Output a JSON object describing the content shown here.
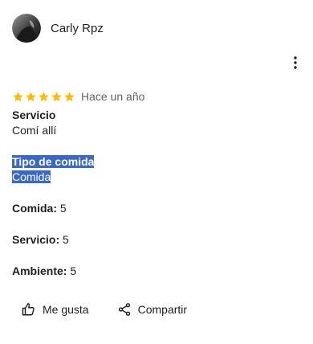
{
  "review": {
    "author": "Carly Rpz",
    "rating": 5,
    "rating_max": 5,
    "time_ago": "Hace un año",
    "colors": {
      "star": "#fbbc04",
      "selection": "#3a68c9"
    },
    "fields": {
      "servicio_title": "Servicio",
      "servicio_value": "Comí allí",
      "tipo_comida_title": "Tipo de comida",
      "tipo_comida_value": "Comida"
    },
    "ratings": [
      {
        "label": "Comida:",
        "value": "5"
      },
      {
        "label": "Servicio:",
        "value": "5"
      },
      {
        "label": "Ambiente:",
        "value": "5"
      }
    ]
  },
  "actions": {
    "like_label": "Me gusta",
    "share_label": "Compartir"
  },
  "icons": {
    "more": "more-vert-icon",
    "like": "thumb-up-icon",
    "share": "share-icon",
    "star": "star-icon"
  }
}
